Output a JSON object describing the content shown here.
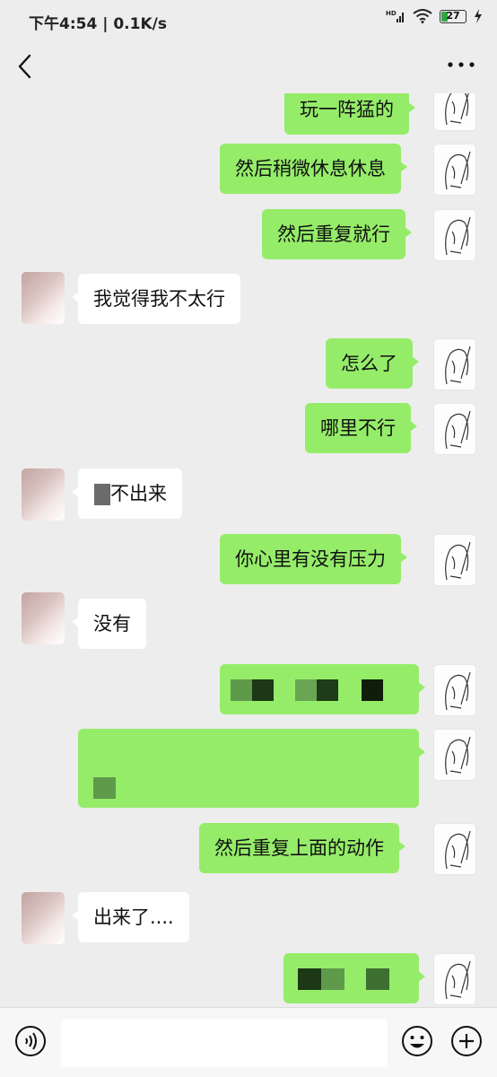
{
  "status_bar": {
    "text": "下午4:54 | 0.1K/s",
    "network": "HD",
    "battery": "27",
    "battery_level": 0.27
  },
  "header": {
    "back_icon": "chevron-left-icon",
    "title": "",
    "more_icon": "ellipsis-icon"
  },
  "messages": [
    {
      "sender": "me",
      "text": "玩一阵猛的"
    },
    {
      "sender": "me",
      "text": "然后稍微休息休息"
    },
    {
      "sender": "me",
      "text": "然后重复就行"
    },
    {
      "sender": "other",
      "text": "我觉得我不太行"
    },
    {
      "sender": "me",
      "text": "怎么了"
    },
    {
      "sender": "me",
      "text": "哪里不行"
    },
    {
      "sender": "other",
      "text": "不出来"
    },
    {
      "sender": "me",
      "text": "你心里有没有压力"
    },
    {
      "sender": "other",
      "text": "没有"
    },
    {
      "sender": "me",
      "text": ""
    },
    {
      "sender": "me",
      "text": ""
    },
    {
      "sender": "me",
      "text": "然后重复上面的动作"
    },
    {
      "sender": "other",
      "text": "出来了...."
    },
    {
      "sender": "me",
      "text": ""
    }
  ],
  "input_bar": {
    "value": "",
    "voice_icon": "voice-icon",
    "emoji_icon": "emoji-icon",
    "plus_icon": "plus-icon"
  },
  "colors": {
    "background": "#ededed",
    "bubble_me": "#95ec69",
    "bubble_other": "#ffffff"
  }
}
